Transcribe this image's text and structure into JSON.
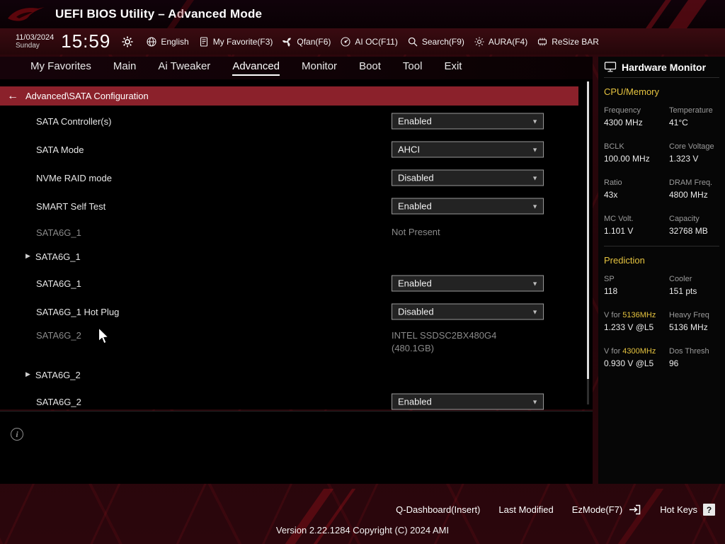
{
  "titlebar": {
    "title": "UEFI BIOS Utility – Advanced Mode"
  },
  "toolbar": {
    "date": "11/03/2024",
    "day": "Sunday",
    "time": "15:59",
    "language": "English",
    "my_favorite": "My Favorite(F3)",
    "qfan": "Qfan(F6)",
    "ai_oc": "AI OC(F11)",
    "search": "Search(F9)",
    "aura": "AURA(F4)",
    "resize_bar": "ReSize BAR"
  },
  "nav": {
    "tabs": [
      {
        "label": "My Favorites",
        "active": false
      },
      {
        "label": "Main",
        "active": false
      },
      {
        "label": "Ai Tweaker",
        "active": false
      },
      {
        "label": "Advanced",
        "active": true
      },
      {
        "label": "Monitor",
        "active": false
      },
      {
        "label": "Boot",
        "active": false
      },
      {
        "label": "Tool",
        "active": false
      },
      {
        "label": "Exit",
        "active": false
      }
    ]
  },
  "content": {
    "breadcrumb": "Advanced\\SATA Configuration",
    "rows": [
      {
        "type": "dropdown",
        "label": "SATA Controller(s)",
        "value": "Enabled"
      },
      {
        "type": "dropdown",
        "label": "SATA Mode",
        "value": "AHCI"
      },
      {
        "type": "dropdown",
        "label": "NVMe RAID mode",
        "value": "Disabled"
      },
      {
        "type": "dropdown",
        "label": "SMART Self Test",
        "value": "Enabled"
      },
      {
        "type": "static",
        "label": "SATA6G_1",
        "value": "Not Present"
      },
      {
        "type": "expand",
        "label": "SATA6G_1"
      },
      {
        "type": "dropdown",
        "label": "SATA6G_1",
        "value": "Enabled"
      },
      {
        "type": "dropdown",
        "label": "SATA6G_1 Hot Plug",
        "value": "Disabled"
      },
      {
        "type": "static",
        "label": "SATA6G_2",
        "value": "INTEL SSDSC2BX480G4\n(480.1GB)"
      },
      {
        "type": "expand",
        "label": "SATA6G_2"
      },
      {
        "type": "dropdown",
        "label": "SATA6G_2",
        "value": "Enabled"
      }
    ]
  },
  "hardware_monitor": {
    "title": "Hardware Monitor",
    "sections": [
      {
        "title": "CPU/Memory",
        "stats": [
          {
            "label": "Frequency",
            "value": "4300 MHz"
          },
          {
            "label": "Temperature",
            "value": "41°C"
          },
          {
            "label": "BCLK",
            "value": "100.00 MHz"
          },
          {
            "label": "Core Voltage",
            "value": "1.323 V"
          },
          {
            "label": "Ratio",
            "value": "43x"
          },
          {
            "label": "DRAM Freq.",
            "value": "4800 MHz"
          },
          {
            "label": "MC Volt.",
            "value": "1.101 V"
          },
          {
            "label": "Capacity",
            "value": "32768 MB"
          }
        ]
      },
      {
        "title": "Prediction",
        "stats": [
          {
            "label": "SP",
            "value": "118"
          },
          {
            "label": "Cooler",
            "value": "151 pts"
          },
          {
            "label": "V for ",
            "label_accent": "5136MHz",
            "value": "1.233 V @L5"
          },
          {
            "label": "Heavy Freq",
            "value": "5136 MHz"
          },
          {
            "label": "V for ",
            "label_accent": "4300MHz",
            "value": "0.930 V @L5"
          },
          {
            "label": "Dos Thresh",
            "value": "96"
          }
        ]
      }
    ]
  },
  "footer": {
    "q_dashboard": "Q-Dashboard(Insert)",
    "last_modified": "Last Modified",
    "ezmode": "EzMode(F7)",
    "hot_keys": "Hot Keys",
    "hot_keys_symbol": "?",
    "version": "Version 2.22.1284 Copyright (C) 2024 AMI"
  },
  "colors": {
    "accent_yellow": "#e5c33f",
    "breadcrumb_red": "#8b212b"
  }
}
